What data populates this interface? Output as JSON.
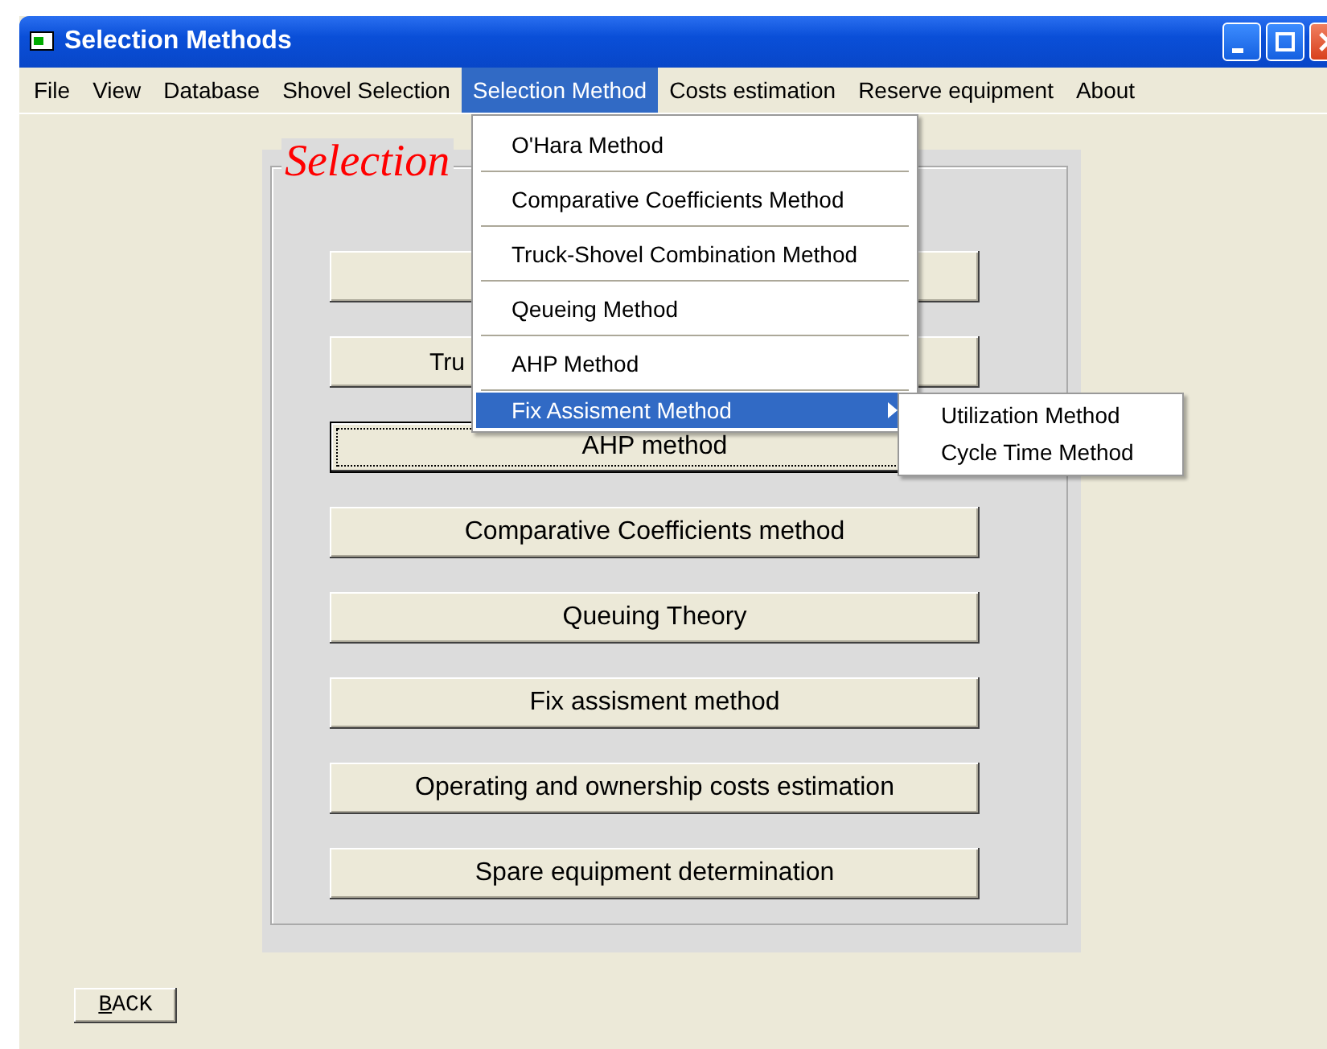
{
  "window": {
    "title": "Selection Methods"
  },
  "menu_bar": [
    {
      "label": "File",
      "selected": false
    },
    {
      "label": "View",
      "selected": false
    },
    {
      "label": "Database",
      "selected": false
    },
    {
      "label": "Shovel Selection",
      "selected": false
    },
    {
      "label": "Selection Method",
      "selected": true
    },
    {
      "label": "Costs estimation",
      "selected": false
    },
    {
      "label": "Reserve equipment",
      "selected": false
    },
    {
      "label": "About",
      "selected": false
    }
  ],
  "dropdown": [
    {
      "label": "O'Hara Method",
      "selected": false,
      "submenu": false
    },
    {
      "label": "Comparative Coefficients Method",
      "selected": false,
      "submenu": false
    },
    {
      "label": "Truck-Shovel Combination Method",
      "selected": false,
      "submenu": false
    },
    {
      "label": "Qeueing Method",
      "selected": false,
      "submenu": false
    },
    {
      "label": "AHP Method",
      "selected": false,
      "submenu": false
    },
    {
      "label": "Fix Assisment Method",
      "selected": true,
      "submenu": true
    }
  ],
  "submenu": [
    {
      "label": "Utilization Method"
    },
    {
      "label": "Cycle Time Method"
    }
  ],
  "panel": {
    "title": "Selection"
  },
  "buttons": [
    {
      "kind": "covered",
      "focused": false
    },
    {
      "kind": "covered",
      "label": "Tru",
      "focused": false
    },
    {
      "kind": "plain",
      "label": "AHP method",
      "focused": true
    },
    {
      "kind": "plain",
      "label": "Comparative Coefficients method",
      "focused": false
    },
    {
      "kind": "plain",
      "label": "Queuing Theory",
      "focused": false
    },
    {
      "kind": "plain",
      "label": "Fix assisment method",
      "focused": false
    },
    {
      "kind": "plain",
      "label": "Operating and ownership costs estimation",
      "focused": false
    },
    {
      "kind": "plain",
      "label": "Spare equipment determination",
      "focused": false
    }
  ],
  "back_button": {
    "label": "BACK"
  }
}
